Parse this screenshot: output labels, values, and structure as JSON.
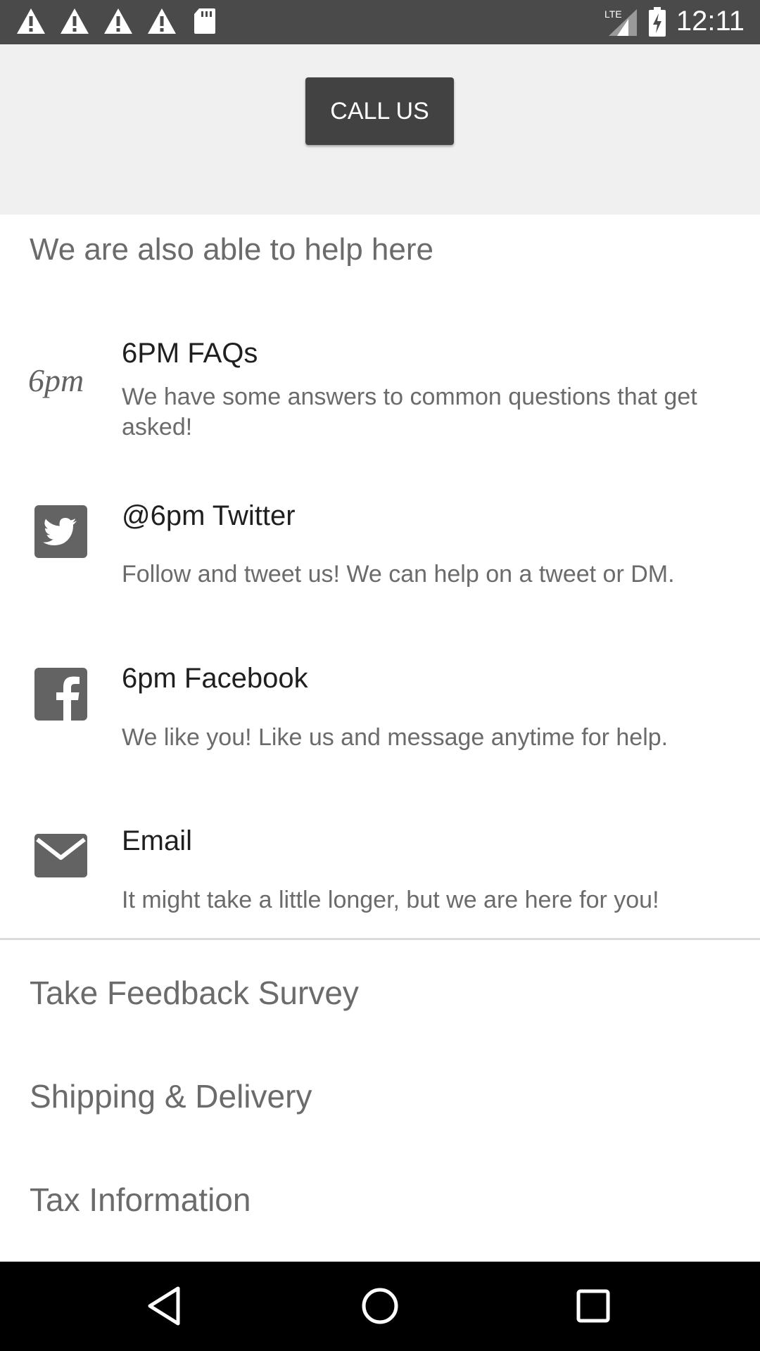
{
  "status_bar": {
    "time": "12:11",
    "network": "LTE",
    "icons": [
      "warning-icon",
      "warning-icon",
      "warning-icon",
      "warning-icon",
      "sdcard-icon",
      "lte-signal-icon",
      "battery-charging-icon"
    ]
  },
  "top": {
    "call_label": "CALL US"
  },
  "help": {
    "heading": "We are also able to help here",
    "items": [
      {
        "icon": "6pm-logo-icon",
        "title": "6PM FAQs",
        "desc": "We have some answers to common questions that get asked!"
      },
      {
        "icon": "twitter-icon",
        "title": "@6pm Twitter",
        "desc": "Follow and tweet us! We can help on a tweet or DM."
      },
      {
        "icon": "facebook-icon",
        "title": "6pm Facebook",
        "desc": "We like you! Like us and message anytime for help."
      },
      {
        "icon": "email-icon",
        "title": "Email",
        "desc": "It might take a little longer, but we are here for you!"
      }
    ]
  },
  "links": [
    {
      "label": "Take Feedback Survey"
    },
    {
      "label": "Shipping & Delivery"
    },
    {
      "label": "Tax Information"
    }
  ],
  "logo_text": "6pm",
  "nav": {
    "icons": [
      "back-icon",
      "home-icon",
      "recents-icon"
    ]
  },
  "colors": {
    "status_bar": "#4a4a4a",
    "top_area": "#f0f0f0",
    "button": "#424242",
    "icon_gray": "#636363",
    "text_secondary": "#6b6b6b",
    "text_primary": "#1f1f1f"
  }
}
